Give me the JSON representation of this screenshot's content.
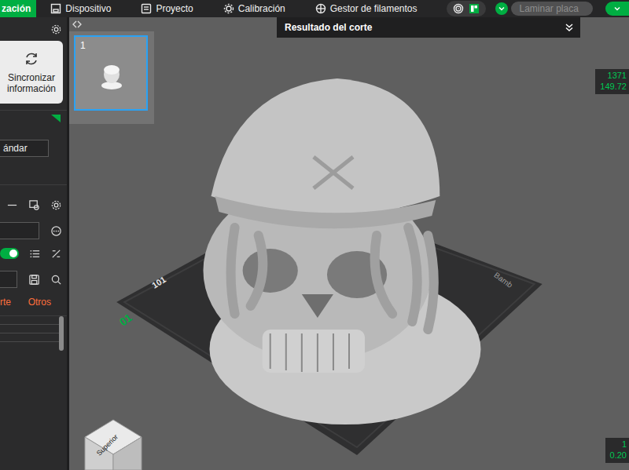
{
  "toolbar": {
    "tabs": [
      {
        "label": "zación",
        "selected": true
      },
      {
        "label": "Dispositivo",
        "selected": false
      },
      {
        "label": "Proyecto",
        "selected": false
      },
      {
        "label": "Calibración",
        "selected": false
      },
      {
        "label": "Gestor de filamentos",
        "selected": false
      }
    ],
    "slice_button": {
      "label": "Laminar placa",
      "disabled": true
    }
  },
  "sidebar": {
    "sync_button": "Sincronizar información",
    "profile_field": "ándar",
    "profile_toggle": {
      "on": true
    },
    "settings_tabs": [
      "rte",
      "Otros"
    ]
  },
  "plates": [
    {
      "number": "1",
      "selected": true
    }
  ],
  "viewport": {
    "header": "Resultado del corte",
    "layer_top": {
      "layer": "1371",
      "height": "149.72"
    },
    "layer_bottom": {
      "layer": "1",
      "height": "0.20"
    },
    "view_cube": "Superior",
    "plate_marks": [
      "01",
      "101",
      "Bamb"
    ]
  }
}
